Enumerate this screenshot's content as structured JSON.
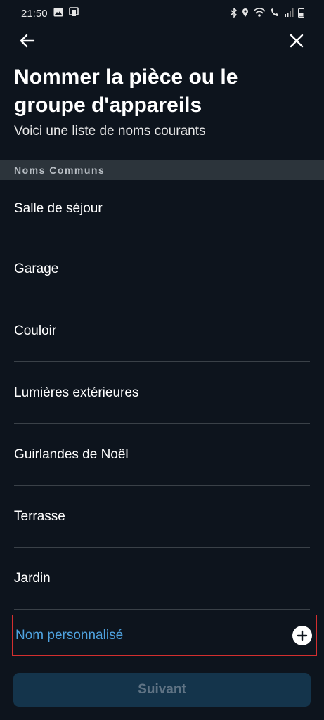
{
  "status_bar": {
    "time": "21:50",
    "left_icons": [
      "image-icon",
      "cast-icon"
    ],
    "right_icons": [
      "bluetooth-icon",
      "location-icon",
      "wifi-calling-icon",
      "volte-icon",
      "signal-icon",
      "battery-icon"
    ]
  },
  "nav": {
    "back_icon": "arrow-left-icon",
    "close_icon": "close-icon"
  },
  "header": {
    "title": "Nommer la pièce ou le groupe d'appareils",
    "subtitle": "Voici une liste de noms courants"
  },
  "section": {
    "label": "Noms Communs"
  },
  "list": {
    "items": [
      {
        "label": "Salle de séjour"
      },
      {
        "label": "Garage"
      },
      {
        "label": "Couloir"
      },
      {
        "label": "Lumières extérieures"
      },
      {
        "label": "Guirlandes de Noël"
      },
      {
        "label": "Terrasse"
      },
      {
        "label": "Jardin"
      }
    ]
  },
  "custom": {
    "label": "Nom personnalisé",
    "icon": "plus-circle-icon"
  },
  "footer": {
    "next_label": "Suivant"
  },
  "colors": {
    "background": "#0d141d",
    "section_header_bg": "#2c343b",
    "link_blue": "#4fa3e0",
    "button_disabled_bg": "#14344b",
    "highlight_border": "#d32f2f"
  }
}
